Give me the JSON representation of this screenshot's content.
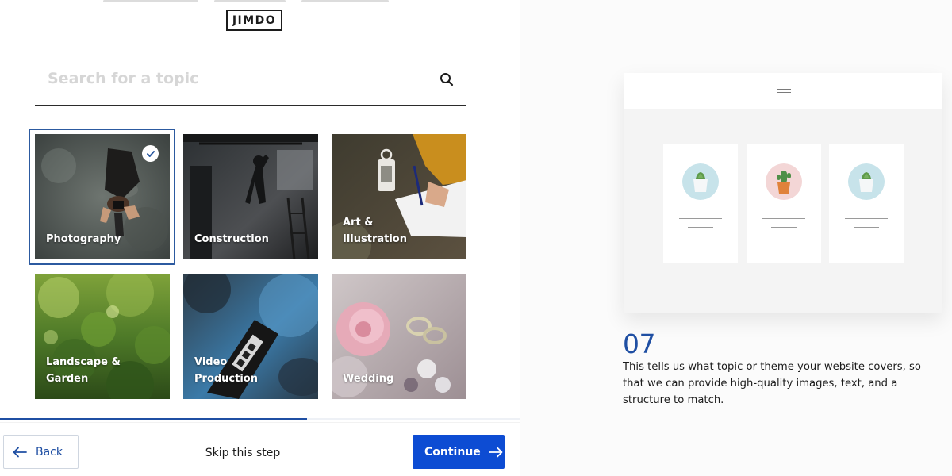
{
  "brand": {
    "logo_text": "JIMDO"
  },
  "search": {
    "placeholder": "Search for a topic",
    "icon": "search-icon"
  },
  "topics": [
    {
      "label": "Photography",
      "selected": true
    },
    {
      "label": "Construction",
      "selected": false
    },
    {
      "label": "Art & Illustration",
      "selected": false
    },
    {
      "label": "Landscape & Garden",
      "selected": false
    },
    {
      "label": "Video Production",
      "selected": false
    },
    {
      "label": "Wedding",
      "selected": false
    }
  ],
  "progress": {
    "fraction": 0.59
  },
  "footer": {
    "back_label": "Back",
    "skip_label": "Skip this step",
    "continue_label": "Continue"
  },
  "info": {
    "step_number": "07",
    "description": "This tells us what topic or theme your website covers, so that we can provide high-quality images, text, and a structure to match."
  },
  "colors": {
    "accent": "#1f4fa3",
    "continue_bg": "#0d4cd3",
    "selected_border": "#2c5aa0"
  }
}
